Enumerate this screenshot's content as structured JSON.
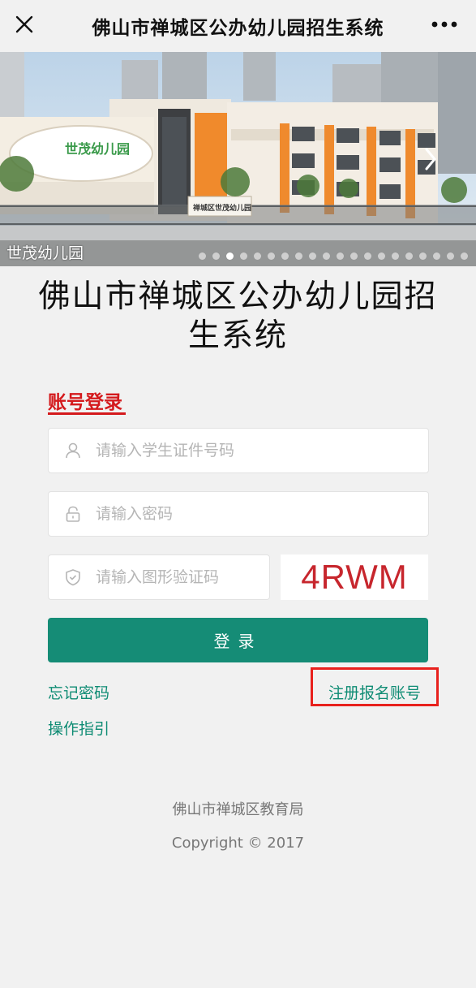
{
  "header": {
    "title": "佛山市禅城区公办幼儿园招生系统",
    "close_icon": "close-icon",
    "more_icon": "more-icon"
  },
  "banner": {
    "caption": "世茂幼儿园",
    "dots_total": 20,
    "active_dot": 3,
    "sign_text": "世茂幼儿园",
    "gate_sign_text": "禅城区世茂幼儿园"
  },
  "main": {
    "title": "佛山市禅城区公办幼儿园招生系统"
  },
  "login": {
    "tab_label": "账号登录",
    "account_placeholder": "请输入学生证件号码",
    "password_placeholder": "请输入密码",
    "captcha_placeholder": "请输入图形验证码",
    "captcha_code": "4RWM",
    "button_label": "登录"
  },
  "links": {
    "forgot_password": "忘记密码",
    "register": "注册报名账号",
    "guide": "操作指引"
  },
  "footer": {
    "org": "佛山市禅城区教育局",
    "copyright": "Copyright © 2017"
  },
  "colors": {
    "primary": "#158c76",
    "accent_red": "#d4191c",
    "highlight_box": "#e8211d"
  }
}
